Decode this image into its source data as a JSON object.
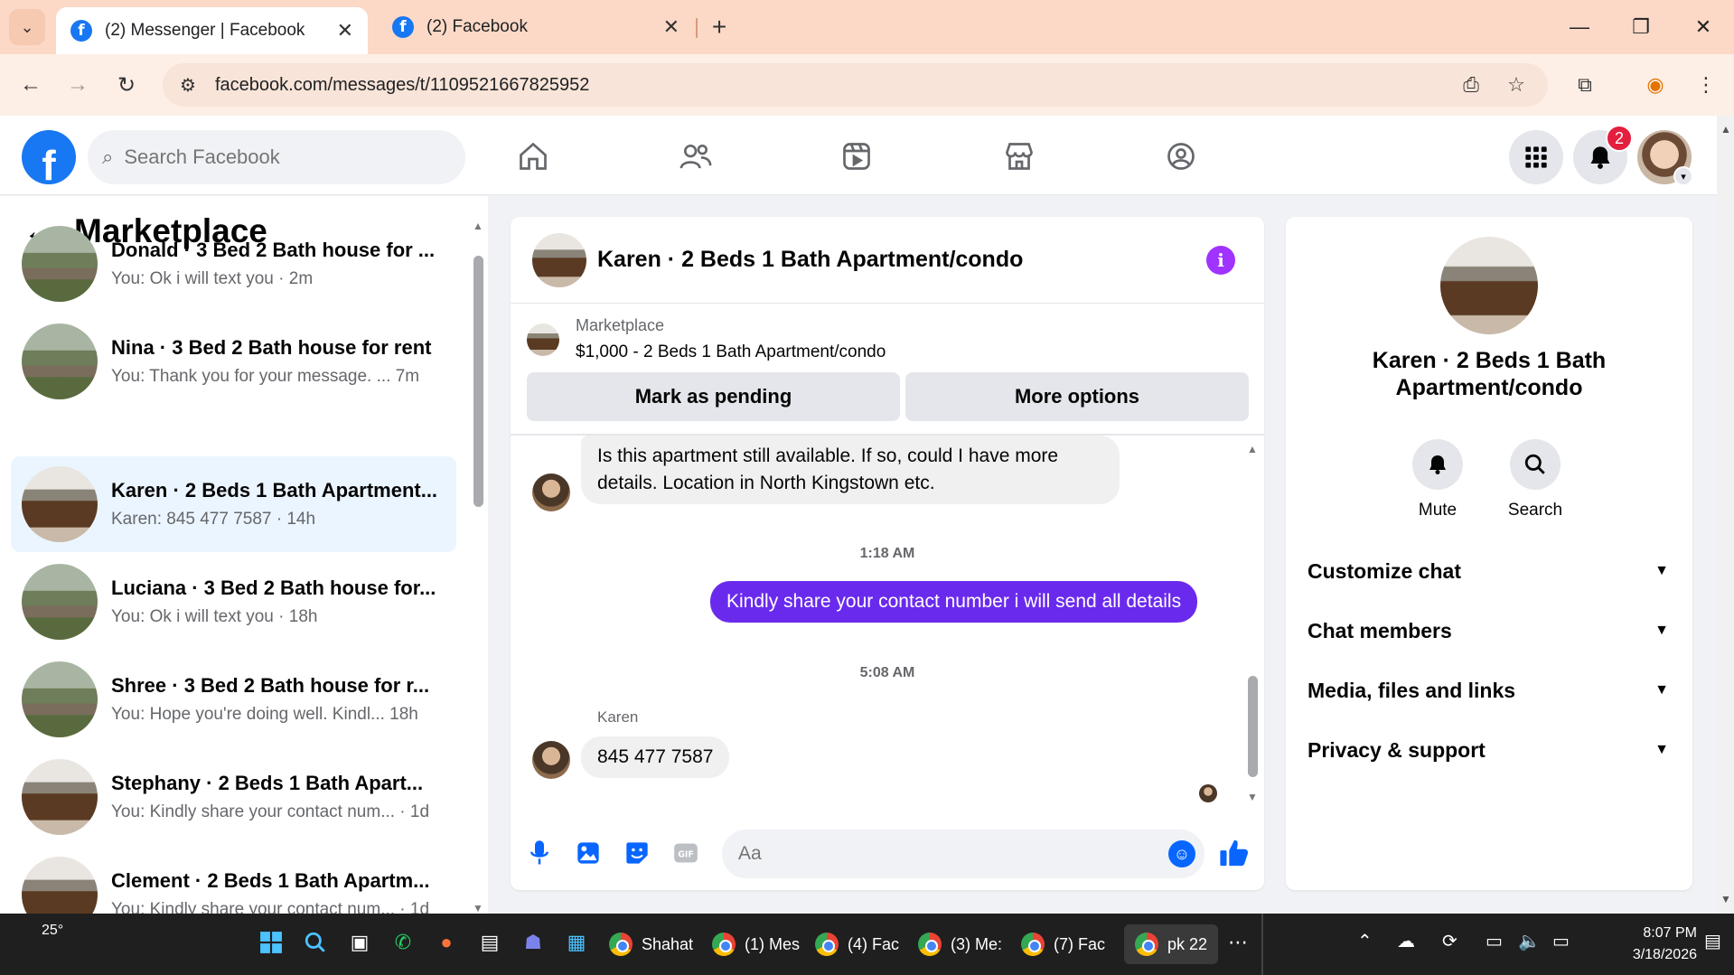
{
  "browser": {
    "tabs": [
      {
        "title": "(2) Messenger | Facebook",
        "active": true
      },
      {
        "title": "(2) Facebook",
        "active": false
      }
    ],
    "url": "facebook.com/messages/t/1109521667825952"
  },
  "fb_header": {
    "search_placeholder": "Search Facebook",
    "notification_count": "2",
    "nav_icons": [
      "home-icon",
      "friends-icon",
      "video-icon",
      "marketplace-icon",
      "gaming-icon"
    ]
  },
  "sidebar": {
    "title": "Marketplace",
    "conversations": [
      {
        "name": "Donald · 3 Bed 2 Bath house for ...",
        "snippet": "You: Ok i will text you · 2m",
        "thumb": "house"
      },
      {
        "name": "Nina · 3 Bed 2 Bath house for rent",
        "snippet": "You: Thank you for your message. ...  7m",
        "thumb": "house"
      },
      {
        "name": "Karen · 2 Beds 1 Bath Apartment...",
        "snippet": "Karen: 845 477 7587 · 14h",
        "thumb": "kitchen"
      },
      {
        "name": "Luciana · 3 Bed 2 Bath house for...",
        "snippet": "You: Ok i will text you · 18h",
        "thumb": "house"
      },
      {
        "name": "Shree · 3 Bed 2 Bath house for r...",
        "snippet": "You: Hope you're doing well. Kindl...  18h",
        "thumb": "house"
      },
      {
        "name": "Stephany · 2 Beds 1 Bath Apart...",
        "snippet": "You: Kindly share your contact num... · 1d",
        "thumb": "kitchen"
      },
      {
        "name": "Clement · 2 Beds 1 Bath Apartm...",
        "snippet": "You: Kindly share your contact num... · 1d",
        "thumb": "kitchen"
      }
    ]
  },
  "chat": {
    "title": "Karen · 2 Beds 1 Bath Apartment/condo",
    "marketplace_label": "Marketplace",
    "listing": "$1,000 - 2 Beds 1 Bath Apartment/condo",
    "mark_pending_label": "Mark as pending",
    "more_options_label": "More options",
    "messages": {
      "m1": "Is this apartment still available. If so, could I have more details. Location in North Kingstown etc.",
      "ts1": "1:18 AM",
      "m2": "Kindly share your contact number i will send all details",
      "ts2": "5:08 AM",
      "sender": "Karen",
      "m3": "845 477 7587"
    },
    "composer_placeholder": "Aa"
  },
  "info_panel": {
    "title": "Karen · 2 Beds 1 Bath Apartment/condo",
    "mute_label": "Mute",
    "search_label": "Search",
    "sections": [
      "Customize chat",
      "Chat members",
      "Media, files and links",
      "Privacy & support"
    ]
  },
  "taskbar": {
    "temperature": "25°",
    "apps": [
      {
        "label": "Shahat"
      },
      {
        "label": "(1) Mes"
      },
      {
        "label": "(4) Fac"
      },
      {
        "label": "(3) Me:"
      },
      {
        "label": "(7) Fac"
      },
      {
        "label": "pk 22"
      }
    ],
    "time": "8:07 PM",
    "date": "3/18/2026"
  },
  "colors": {
    "fb_blue": "#1877f2",
    "outgoing_bubble": "#6a2aed",
    "active_conv_bg": "#ebf5ff",
    "tabbar": "#fbd9c6"
  }
}
